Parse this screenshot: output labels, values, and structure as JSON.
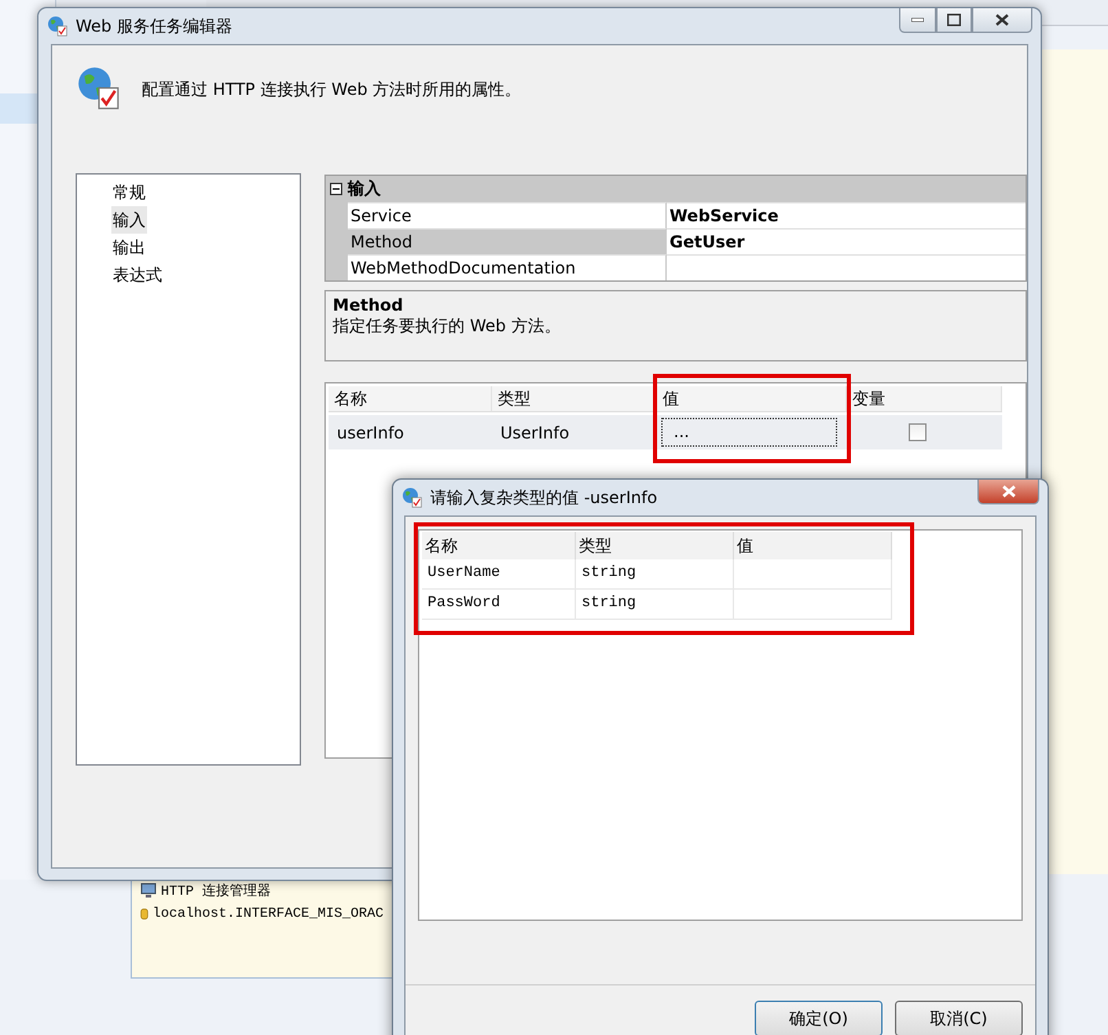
{
  "background": {
    "connection_items": [
      {
        "label": "HTTP 连接管理器",
        "kind": "http"
      },
      {
        "label": "localhost.INTERFACE_MIS_ORAC",
        "kind": "database"
      }
    ]
  },
  "main_window": {
    "title": "Web 服务任务编辑器",
    "description": "配置通过 HTTP 连接执行 Web 方法时所用的属性。",
    "nav_items": [
      {
        "label": "常规",
        "selected": false
      },
      {
        "label": "输入",
        "selected": true
      },
      {
        "label": "输出",
        "selected": false
      },
      {
        "label": "表达式",
        "selected": false
      }
    ],
    "property_grid": {
      "category": "输入",
      "expanded": true,
      "rows": [
        {
          "name": "Service",
          "value": "WebService",
          "selected": false
        },
        {
          "name": "Method",
          "value": "GetUser",
          "selected": true
        },
        {
          "name": "WebMethodDocumentation",
          "selected": false
        }
      ]
    },
    "help": {
      "title": "Method",
      "text": "指定任务要执行的 Web 方法。"
    },
    "inputs_table": {
      "columns": [
        "名称",
        "类型",
        "值",
        "变量"
      ],
      "rows": [
        {
          "name": "userInfo",
          "type": "UserInfo",
          "value": "...",
          "variable": false
        }
      ]
    }
  },
  "dialog": {
    "title": "请输入复杂类型的值 -userInfo",
    "table": {
      "columns": [
        "名称",
        "类型",
        "值"
      ],
      "rows": [
        {
          "name": "UserName",
          "type": "string"
        },
        {
          "name": "PassWord",
          "type": "string"
        }
      ]
    },
    "buttons": [
      "确定(O)",
      "取消(C)"
    ]
  }
}
